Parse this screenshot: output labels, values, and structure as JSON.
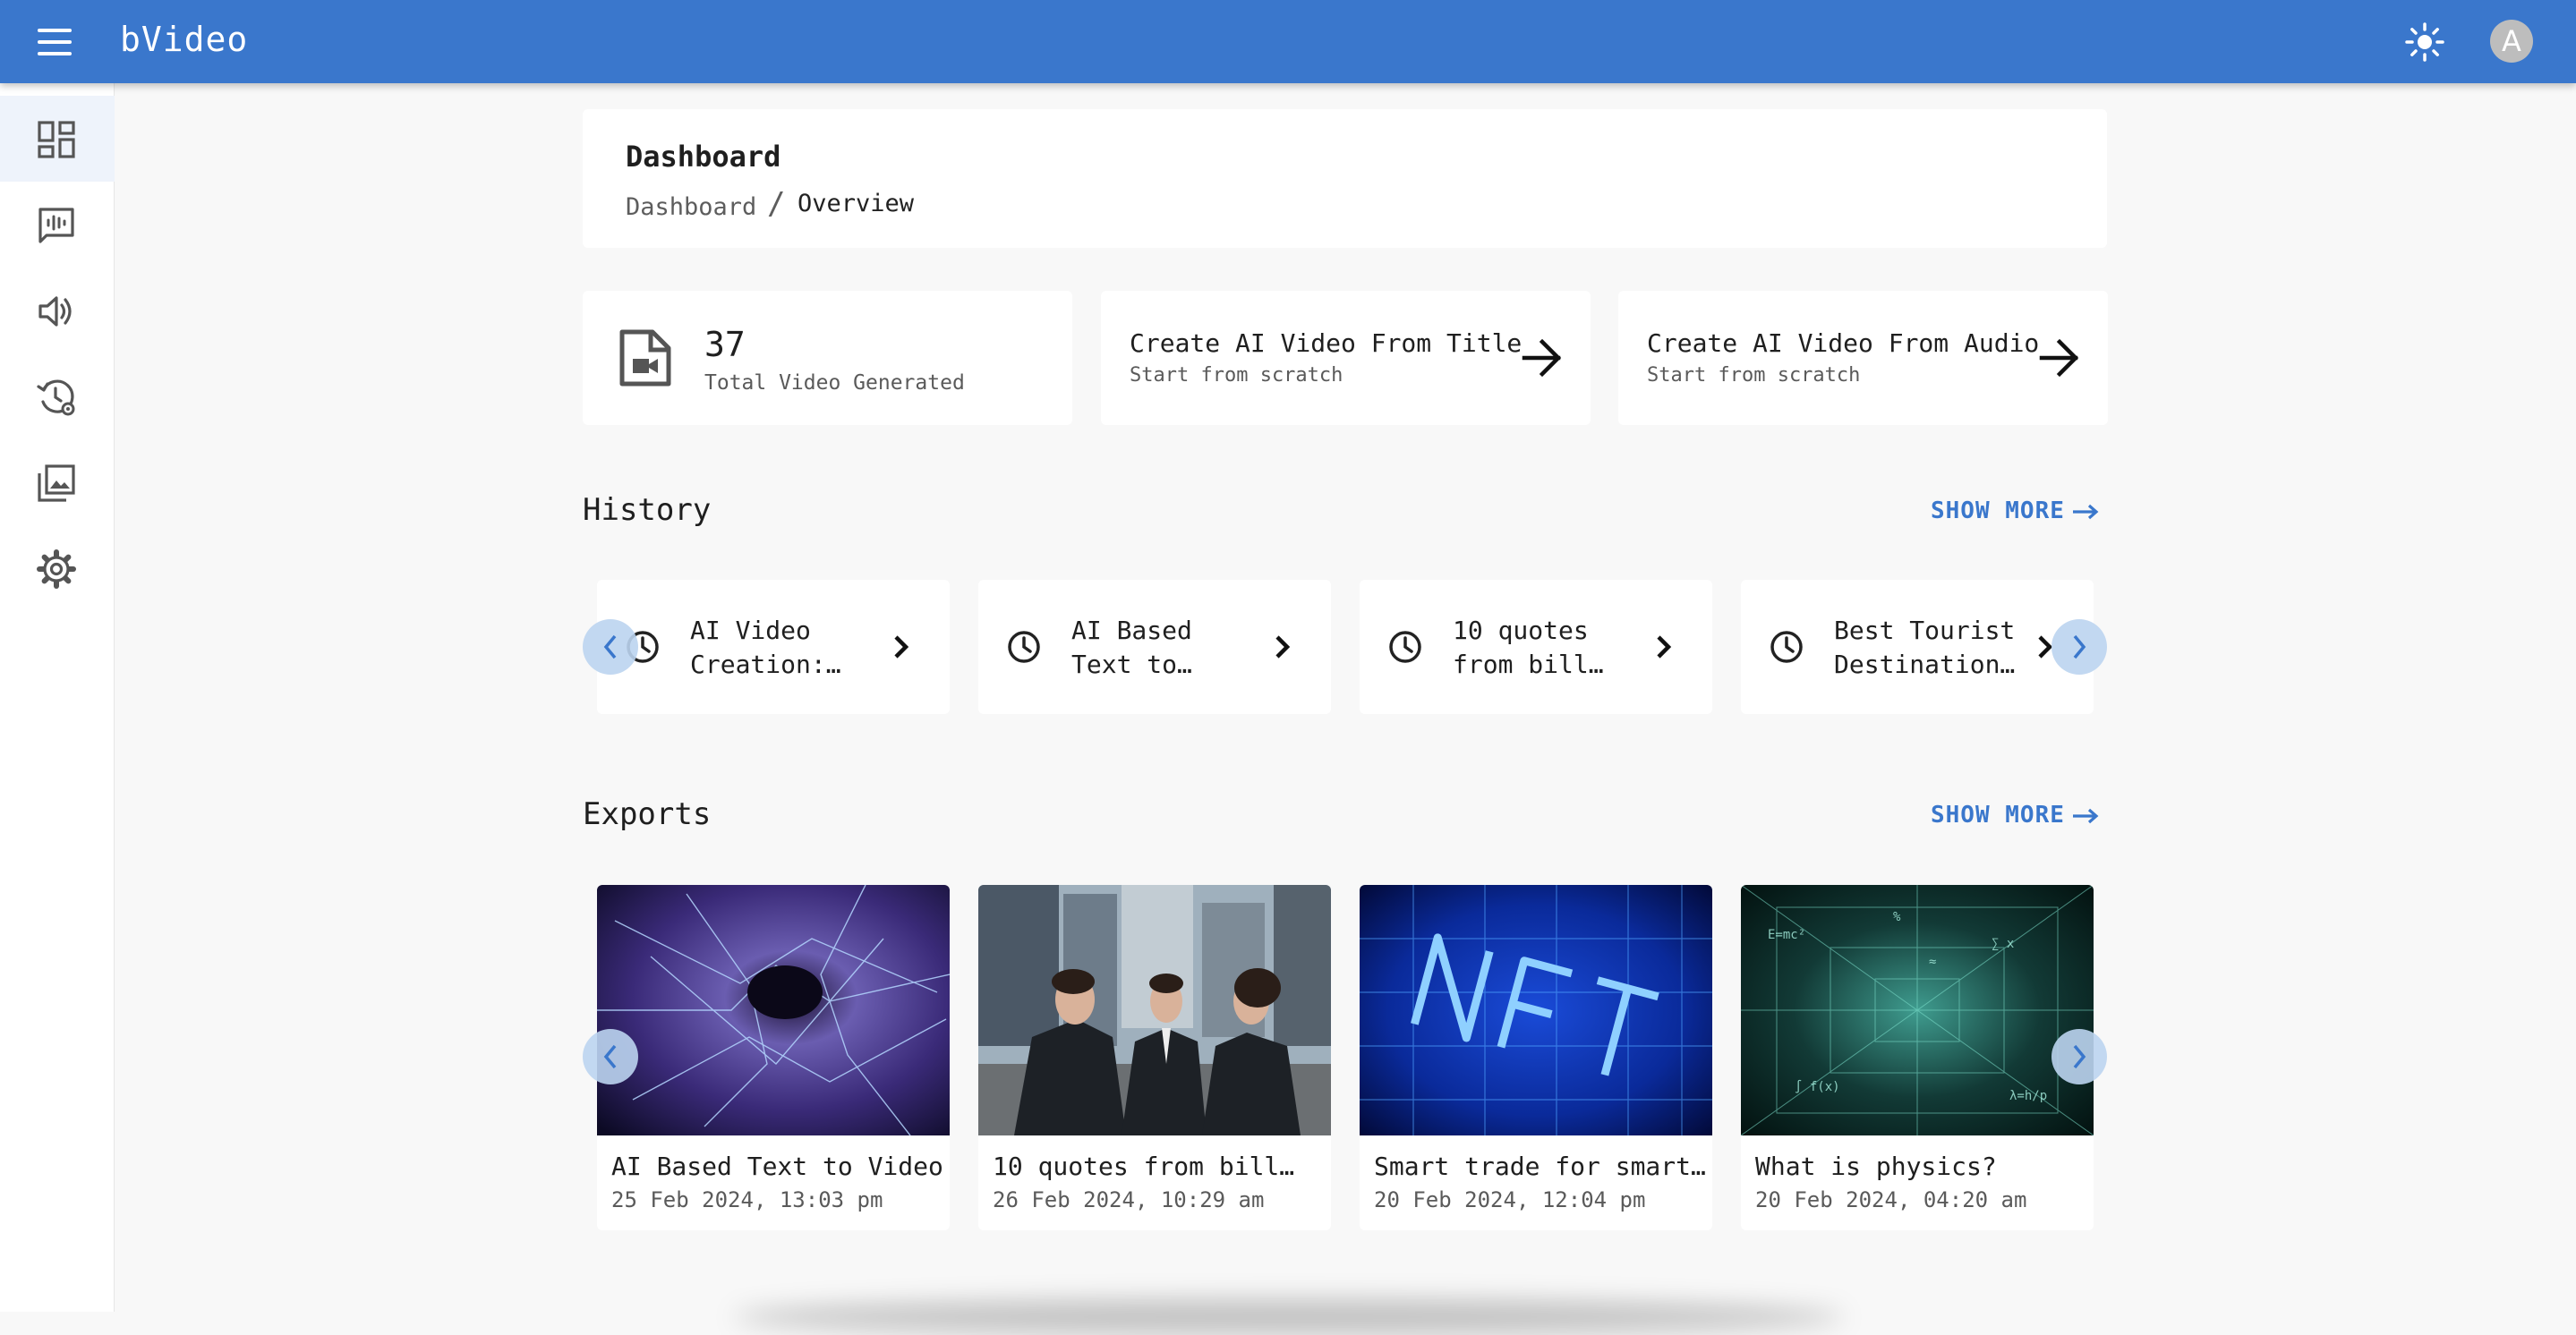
{
  "app": {
    "title": "bVideo",
    "avatar_letter": "A",
    "accent": "#3a77cc"
  },
  "sidebar": {
    "items": [
      {
        "name": "dashboard",
        "icon": "dashboard-icon",
        "active": true
      },
      {
        "name": "text-to-video",
        "icon": "voice-chat-icon",
        "active": false
      },
      {
        "name": "audio",
        "icon": "speaker-icon",
        "active": false
      },
      {
        "name": "history-settings",
        "icon": "history-gear-icon",
        "active": false
      },
      {
        "name": "media-library",
        "icon": "photo-library-icon",
        "active": false
      },
      {
        "name": "settings",
        "icon": "gear-icon",
        "active": false
      }
    ]
  },
  "header": {
    "title": "Dashboard",
    "breadcrumb": [
      "Dashboard",
      "Overview"
    ],
    "separator": "/"
  },
  "stats": {
    "total_count": "37",
    "total_label": "Total Video Generated",
    "actions": [
      {
        "title": "Create AI Video From Title",
        "subtitle": "Start from scratch"
      },
      {
        "title": "Create AI Video From Audio",
        "subtitle": "Start from scratch"
      }
    ]
  },
  "history": {
    "title": "History",
    "show_more": "SHOW MORE",
    "items": [
      {
        "line1": "AI Video",
        "line2": "Creation:…"
      },
      {
        "line1": "AI Based",
        "line2": "Text to…"
      },
      {
        "line1": "10 quotes",
        "line2": "from bill…"
      },
      {
        "line1": "Best Tourist",
        "line2": "Destination…"
      }
    ]
  },
  "exports": {
    "title": "Exports",
    "show_more": "SHOW MORE",
    "items": [
      {
        "title": "AI Based Text to Video…",
        "date": "25 Feb 2024, 13:03 pm",
        "thumb": "blue-vortex"
      },
      {
        "title": "10 quotes from bill…",
        "date": "26 Feb 2024, 10:29 am",
        "thumb": "business-people"
      },
      {
        "title": "Smart trade for smart…",
        "date": "20 Feb 2024, 12:04 pm",
        "thumb": "nft-neon"
      },
      {
        "title": "What is physics?",
        "date": "20 Feb 2024, 04:20 am",
        "thumb": "green-formulas"
      }
    ]
  }
}
